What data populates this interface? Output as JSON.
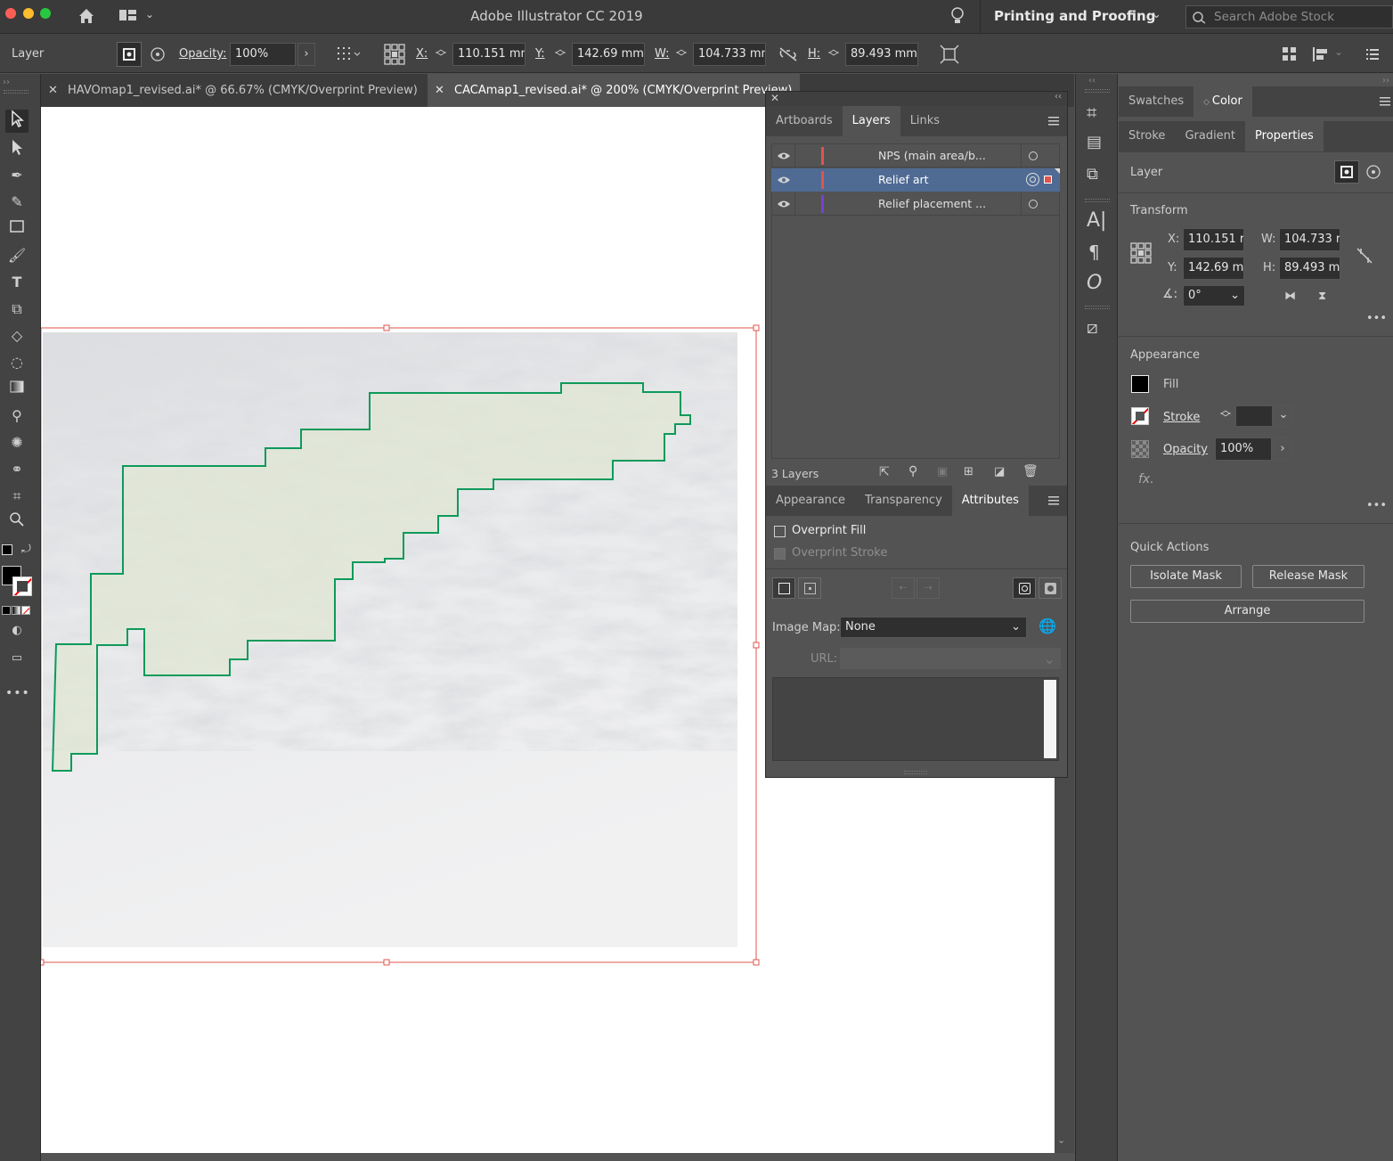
{
  "app": {
    "title": "Adobe Illustrator CC 2019",
    "workspace": "Printing and Proofing",
    "search_placeholder": "Search Adobe Stock"
  },
  "control": {
    "object_type": "Layer",
    "opacity_label": "Opacity:",
    "opacity_value": "100%",
    "x_label": "X:",
    "x_value": "110.151 mm",
    "y_label": "Y:",
    "y_value": "142.69 mm",
    "w_label": "W:",
    "w_value": "104.733 mm",
    "h_label": "H:",
    "h_value": "89.493 mm"
  },
  "tabs": [
    {
      "label": "HAVOmap1_revised.ai* @ 66.67% (CMYK/Overprint Preview)"
    },
    {
      "label": "CACAmap1_revised.ai* @ 200% (CMYK/Overprint Preview)"
    }
  ],
  "layers_panel": {
    "tabs": [
      "Artboards",
      "Layers",
      "Links"
    ],
    "layers": [
      {
        "name": "NPS (main area/b...",
        "color": "#e0544c"
      },
      {
        "name": "Relief art",
        "color": "#e0544c"
      },
      {
        "name": "Relief placement ...",
        "color": "#7a3fd8"
      }
    ],
    "count": "3 Layers"
  },
  "attributes_panel": {
    "tabs": [
      "Appearance",
      "Transparency",
      "Attributes"
    ],
    "overprint_fill": "Overprint Fill",
    "overprint_stroke": "Overprint Stroke",
    "image_map_label": "Image Map:",
    "image_map_value": "None",
    "url_label": "URL:"
  },
  "properties_panel": {
    "tabs_row1": [
      "Swatches",
      "Color"
    ],
    "tabs_row2": [
      "Stroke",
      "Gradient",
      "Properties"
    ],
    "object_type": "Layer",
    "transform_title": "Transform",
    "x_label": "X:",
    "x_value": "110.151 r",
    "y_label": "Y:",
    "y_value": "142.69 m",
    "w_label": "W:",
    "w_value": "104.733 r",
    "h_label": "H:",
    "h_value": "89.493 m",
    "angle_value": "0°",
    "appearance_title": "Appearance",
    "fill_label": "Fill",
    "stroke_label": "Stroke",
    "opacity_label": "Opacity",
    "opacity_value": "100%",
    "fx_label": "fx.",
    "quick_actions_title": "Quick Actions",
    "isolate_mask": "Isolate Mask",
    "release_mask": "Release Mask",
    "arrange": "Arrange"
  },
  "colors": {
    "selection": "#e0544c",
    "boundary": "#0e9a5a",
    "layer_purple": "#7a3fd8"
  }
}
